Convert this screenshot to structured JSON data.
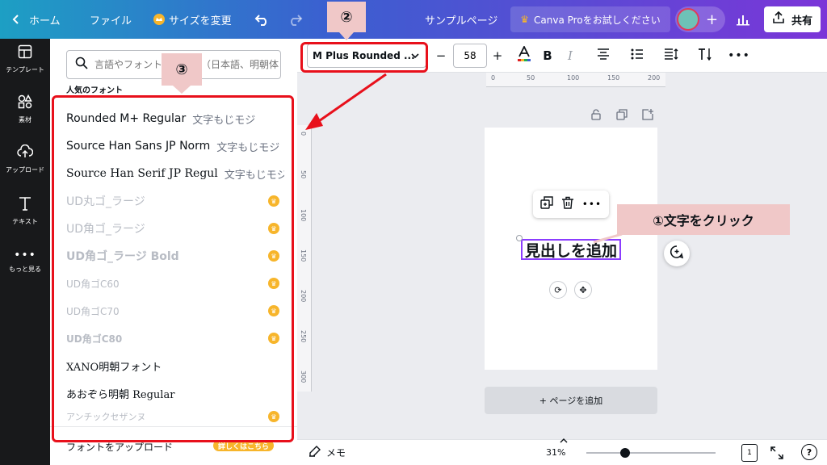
{
  "topbar": {
    "home_label": "ホーム",
    "file_label": "ファイル",
    "resize_label": "サイズを変更",
    "page_title": "サンプルページ",
    "pro_trial_label": "Canva Proをお試しください",
    "share_label": "共有",
    "colors": {
      "gradient_start": "#1d9fc4",
      "gradient_end": "#7b35d8"
    }
  },
  "rail": {
    "items": [
      {
        "label": "テンプレート",
        "icon": "template-icon"
      },
      {
        "label": "素材",
        "icon": "elements-icon"
      },
      {
        "label": "アップロード",
        "icon": "upload-icon"
      },
      {
        "label": "テキスト",
        "icon": "text-icon"
      },
      {
        "label": "もっと見る",
        "icon": "more-icon"
      }
    ]
  },
  "font_panel": {
    "search_placeholder": "言語やフォント名を入力（日本語、明朝体",
    "popular_heading": "人気のフォント",
    "fonts": [
      {
        "name": "Rounded M+ Regular",
        "sample": "文字もじモジ",
        "pro": false
      },
      {
        "name": "Source Han Sans JP Norm",
        "sample": "文字もじモジ",
        "pro": false
      },
      {
        "name": "Source Han Serif JP Regul",
        "sample": "文字もじモジ",
        "pro": false
      },
      {
        "name": "UD丸ゴ_ラージ",
        "sample": "",
        "pro": true
      },
      {
        "name": "UD角ゴ_ラージ",
        "sample": "",
        "pro": true
      },
      {
        "name": "UD角ゴ_ラージ Bold",
        "sample": "",
        "pro": true
      },
      {
        "name": "UD角ゴC60",
        "sample": "",
        "pro": true
      },
      {
        "name": "UD角ゴC70",
        "sample": "",
        "pro": true
      },
      {
        "name": "UD角ゴC80",
        "sample": "",
        "pro": true
      },
      {
        "name": "XANO明朝フォント",
        "sample": "",
        "pro": false
      },
      {
        "name": "あおぞら明朝 Regular",
        "sample": "",
        "pro": false
      },
      {
        "name": "アンチックセザンヌ",
        "sample": "",
        "pro": true
      }
    ],
    "upload_font_label": "フォントをアップロード",
    "pro_link_label": "詳しくはこちら"
  },
  "toolbar": {
    "font_family": "M Plus Rounded ...",
    "font_size": "58"
  },
  "ruler": {
    "h_ticks": [
      "0",
      "50",
      "100",
      "150",
      "200"
    ],
    "v_ticks": [
      "0",
      "50",
      "100",
      "150",
      "200",
      "250",
      "300"
    ]
  },
  "canvas": {
    "heading_text": "見出しを追加",
    "add_page_label": "+ ページを追加"
  },
  "bottombar": {
    "memo_label": "メモ",
    "zoom": "31%",
    "zoom_level": 0.31,
    "page_count": "1"
  },
  "annotations": {
    "step1": "①文字をクリック",
    "step2": "②",
    "step3": "③",
    "color": "#e8101b"
  }
}
